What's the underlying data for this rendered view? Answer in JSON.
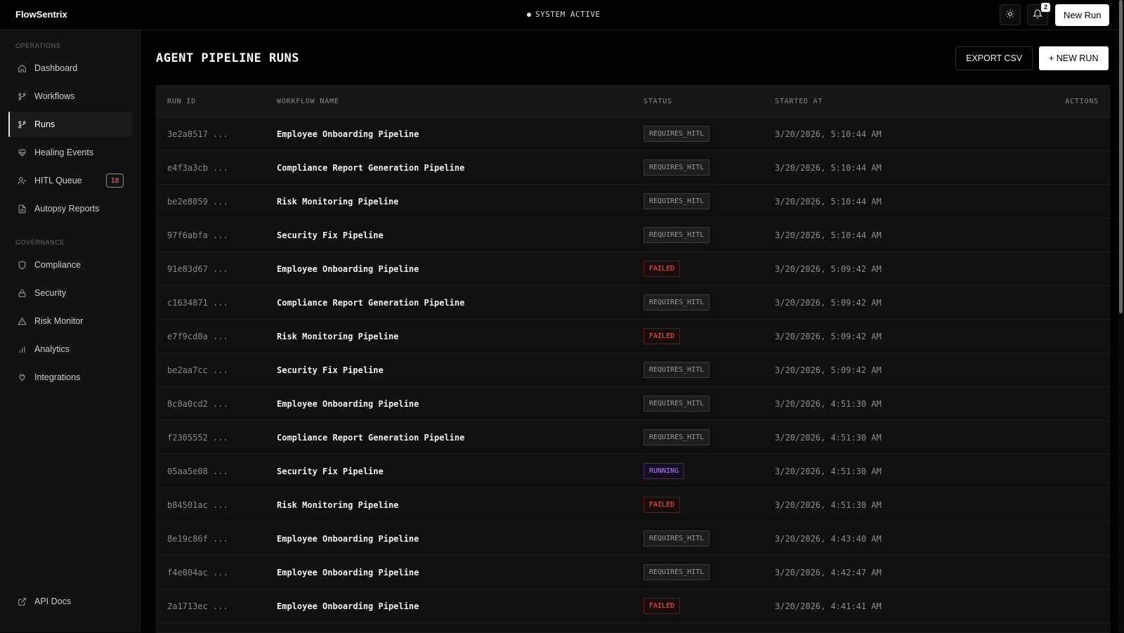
{
  "header": {
    "brand": "FlowSentrix",
    "system_status": "SYSTEM ACTIVE",
    "notification_count": "2",
    "new_run_label": "New Run"
  },
  "sidebar": {
    "operations_label": "OPERATIONS",
    "governance_label": "GOVERNANCE",
    "operations": [
      {
        "label": "Dashboard",
        "icon": "home-icon"
      },
      {
        "label": "Workflows",
        "icon": "workflow-icon"
      },
      {
        "label": "Runs",
        "icon": "branch-icon",
        "active": true
      },
      {
        "label": "Healing Events",
        "icon": "heart-pulse-icon"
      },
      {
        "label": "HITL Queue",
        "icon": "user-check-icon",
        "badge": "18"
      },
      {
        "label": "Autopsy Reports",
        "icon": "document-icon"
      }
    ],
    "governance": [
      {
        "label": "Compliance",
        "icon": "shield-icon"
      },
      {
        "label": "Security",
        "icon": "lock-icon"
      },
      {
        "label": "Risk Monitor",
        "icon": "warning-icon"
      },
      {
        "label": "Analytics",
        "icon": "bar-chart-icon"
      },
      {
        "label": "Integrations",
        "icon": "plug-icon"
      }
    ],
    "footer_link": {
      "label": "API Docs",
      "icon": "external-link-icon"
    }
  },
  "main": {
    "title": "AGENT PIPELINE RUNS",
    "export_label": "EXPORT CSV",
    "new_run_label": "+ NEW RUN",
    "columns": [
      "RUN ID",
      "WORKFLOW NAME",
      "STATUS",
      "STARTED AT",
      "ACTIONS"
    ],
    "rows": [
      {
        "id": "3e2a8517 ...",
        "name": "Employee Onboarding Pipeline",
        "status": "REQUIRES_HITL",
        "started": "3/20/2026, 5:10:44 AM"
      },
      {
        "id": "e4f3a3cb ...",
        "name": "Compliance Report Generation Pipeline",
        "status": "REQUIRES_HITL",
        "started": "3/20/2026, 5:10:44 AM"
      },
      {
        "id": "be2e8059 ...",
        "name": "Risk Monitoring Pipeline",
        "status": "REQUIRES_HITL",
        "started": "3/20/2026, 5:10:44 AM"
      },
      {
        "id": "97f6abfa ...",
        "name": "Security Fix Pipeline",
        "status": "REQUIRES_HITL",
        "started": "3/20/2026, 5:10:44 AM"
      },
      {
        "id": "91e83d67 ...",
        "name": "Employee Onboarding Pipeline",
        "status": "FAILED",
        "started": "3/20/2026, 5:09:42 AM"
      },
      {
        "id": "c1634871 ...",
        "name": "Compliance Report Generation Pipeline",
        "status": "REQUIRES_HITL",
        "started": "3/20/2026, 5:09:42 AM"
      },
      {
        "id": "e7f9cd0a ...",
        "name": "Risk Monitoring Pipeline",
        "status": "FAILED",
        "started": "3/20/2026, 5:09:42 AM"
      },
      {
        "id": "be2aa7cc ...",
        "name": "Security Fix Pipeline",
        "status": "REQUIRES_HITL",
        "started": "3/20/2026, 5:09:42 AM"
      },
      {
        "id": "8c8a0cd2 ...",
        "name": "Employee Onboarding Pipeline",
        "status": "REQUIRES_HITL",
        "started": "3/20/2026, 4:51:30 AM"
      },
      {
        "id": "f2305552 ...",
        "name": "Compliance Report Generation Pipeline",
        "status": "REQUIRES_HITL",
        "started": "3/20/2026, 4:51:30 AM"
      },
      {
        "id": "05aa5e08 ...",
        "name": "Security Fix Pipeline",
        "status": "RUNNING",
        "started": "3/20/2026, 4:51:30 AM"
      },
      {
        "id": "b84501ac ...",
        "name": "Risk Monitoring Pipeline",
        "status": "FAILED",
        "started": "3/20/2026, 4:51:30 AM"
      },
      {
        "id": "8e19c86f ...",
        "name": "Employee Onboarding Pipeline",
        "status": "REQUIRES_HITL",
        "started": "3/20/2026, 4:43:40 AM"
      },
      {
        "id": "f4e004ac ...",
        "name": "Employee Onboarding Pipeline",
        "status": "REQUIRES_HITL",
        "started": "3/20/2026, 4:42:47 AM"
      },
      {
        "id": "2a1713ec ...",
        "name": "Employee Onboarding Pipeline",
        "status": "FAILED",
        "started": "3/20/2026, 4:41:41 AM"
      }
    ]
  },
  "colors": {
    "failed": "#ff5c5c",
    "running": "#b77cff",
    "requires_hitl": "#9a9a9a",
    "hitl_badge": "#ff6b6b"
  }
}
